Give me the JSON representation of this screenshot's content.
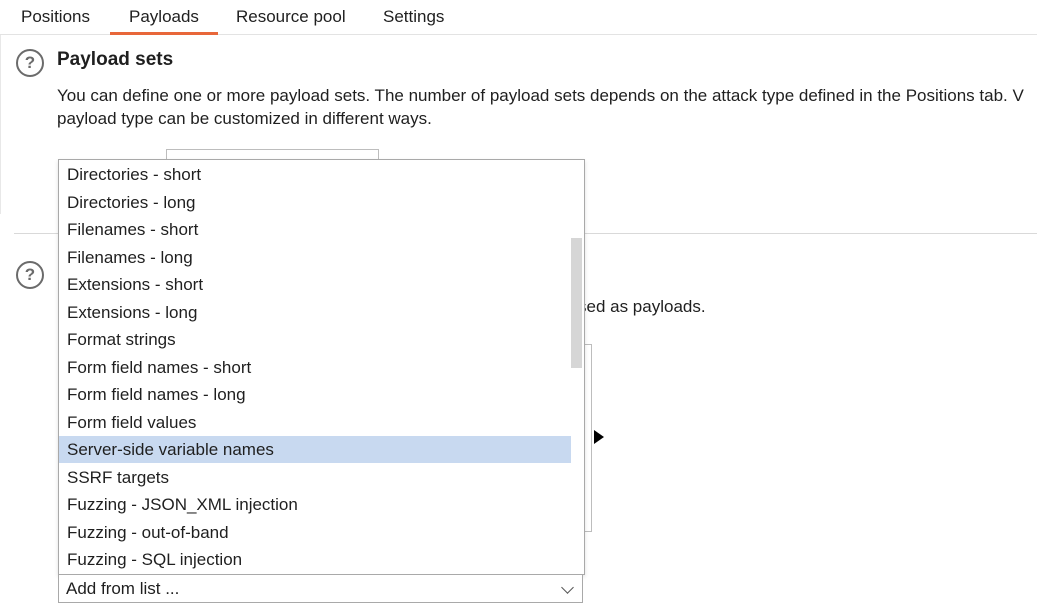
{
  "tabs": [
    {
      "label": "Positions"
    },
    {
      "label": "Payloads"
    },
    {
      "label": "Resource pool"
    },
    {
      "label": "Settings"
    }
  ],
  "payload_sets": {
    "title": "Payload sets",
    "description_line1": "You can define one or more payload sets. The number of payload sets depends on the attack type defined in the Positions tab. V",
    "description_line2": "payload type can be customized in different ways."
  },
  "payload_settings": {
    "partial_description": "sed as payloads."
  },
  "dropdown": {
    "selected_value": "Add from list ...",
    "highlighted_index": 10,
    "items": [
      "Directories - short",
      "Directories - long",
      "Filenames - short",
      "Filenames - long",
      "Extensions - short",
      "Extensions - long",
      "Format strings",
      "Form field names - short",
      "Form field names - long",
      "Form field values",
      "Server-side variable names",
      "SSRF targets",
      "Fuzzing - JSON_XML injection",
      "Fuzzing - out-of-band",
      "Fuzzing - SQL injection"
    ]
  },
  "icons": {
    "help": "question-circle-icon",
    "combo_caret": "chevron-down-icon"
  },
  "colors": {
    "active_tab_underline": "#e8673a",
    "selected_item_bg": "#c8d9f0"
  }
}
